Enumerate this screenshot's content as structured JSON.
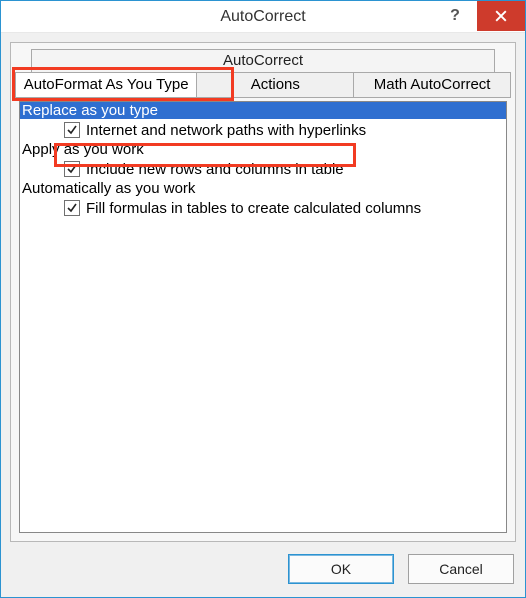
{
  "window": {
    "title": "AutoCorrect"
  },
  "tabs": {
    "upper": "AutoCorrect",
    "active": "AutoFormat As You Type",
    "b": "Actions",
    "c": "Math AutoCorrect"
  },
  "sections": {
    "replace_hdr": "Replace as you type",
    "apply_hdr": "Apply as you work",
    "auto_hdr": "Automatically as you work"
  },
  "opts": {
    "internet": {
      "checked": true,
      "label": "Internet and network paths with hyperlinks"
    },
    "include_rows": {
      "checked": true,
      "label": "Include new rows and columns in table"
    },
    "fill_formulas": {
      "checked": true,
      "label": "Fill formulas in tables to create calculated columns"
    }
  },
  "buttons": {
    "ok": "OK",
    "cancel": "Cancel"
  },
  "highlight_color": "#f23b22"
}
